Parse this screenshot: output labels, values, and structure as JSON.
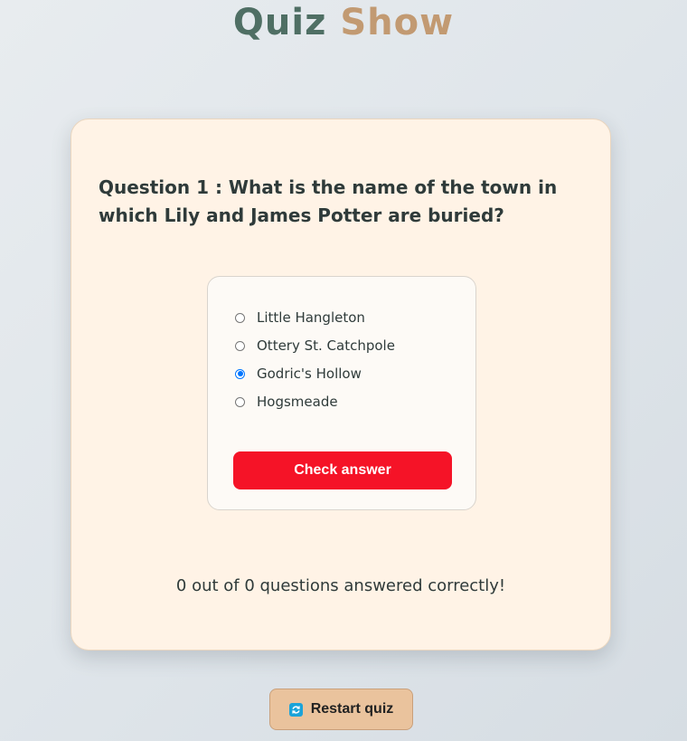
{
  "header": {
    "title_part1": "Quiz",
    "title_part2": "Show"
  },
  "quiz": {
    "question": "Question 1 : What is the name of the town in which Lily and James Potter are buried?",
    "options": [
      {
        "label": "Little Hangleton",
        "selected": false
      },
      {
        "label": "Ottery St. Catchpole",
        "selected": false
      },
      {
        "label": "Godric's Hollow",
        "selected": true
      },
      {
        "label": "Hogsmeade",
        "selected": false
      }
    ],
    "check_button_label": "Check answer",
    "score_text": "0 out of 0 questions answered correctly!"
  },
  "footer": {
    "restart_label": "Restart quiz",
    "restart_icon": "refresh-icon"
  },
  "colors": {
    "title_word1": "#4f6f64",
    "title_word2": "#c29a72",
    "card_background": "#fff3e6",
    "check_button": "#f51327",
    "restart_button": "#eac39d",
    "radio_selected": "#0075ff"
  }
}
